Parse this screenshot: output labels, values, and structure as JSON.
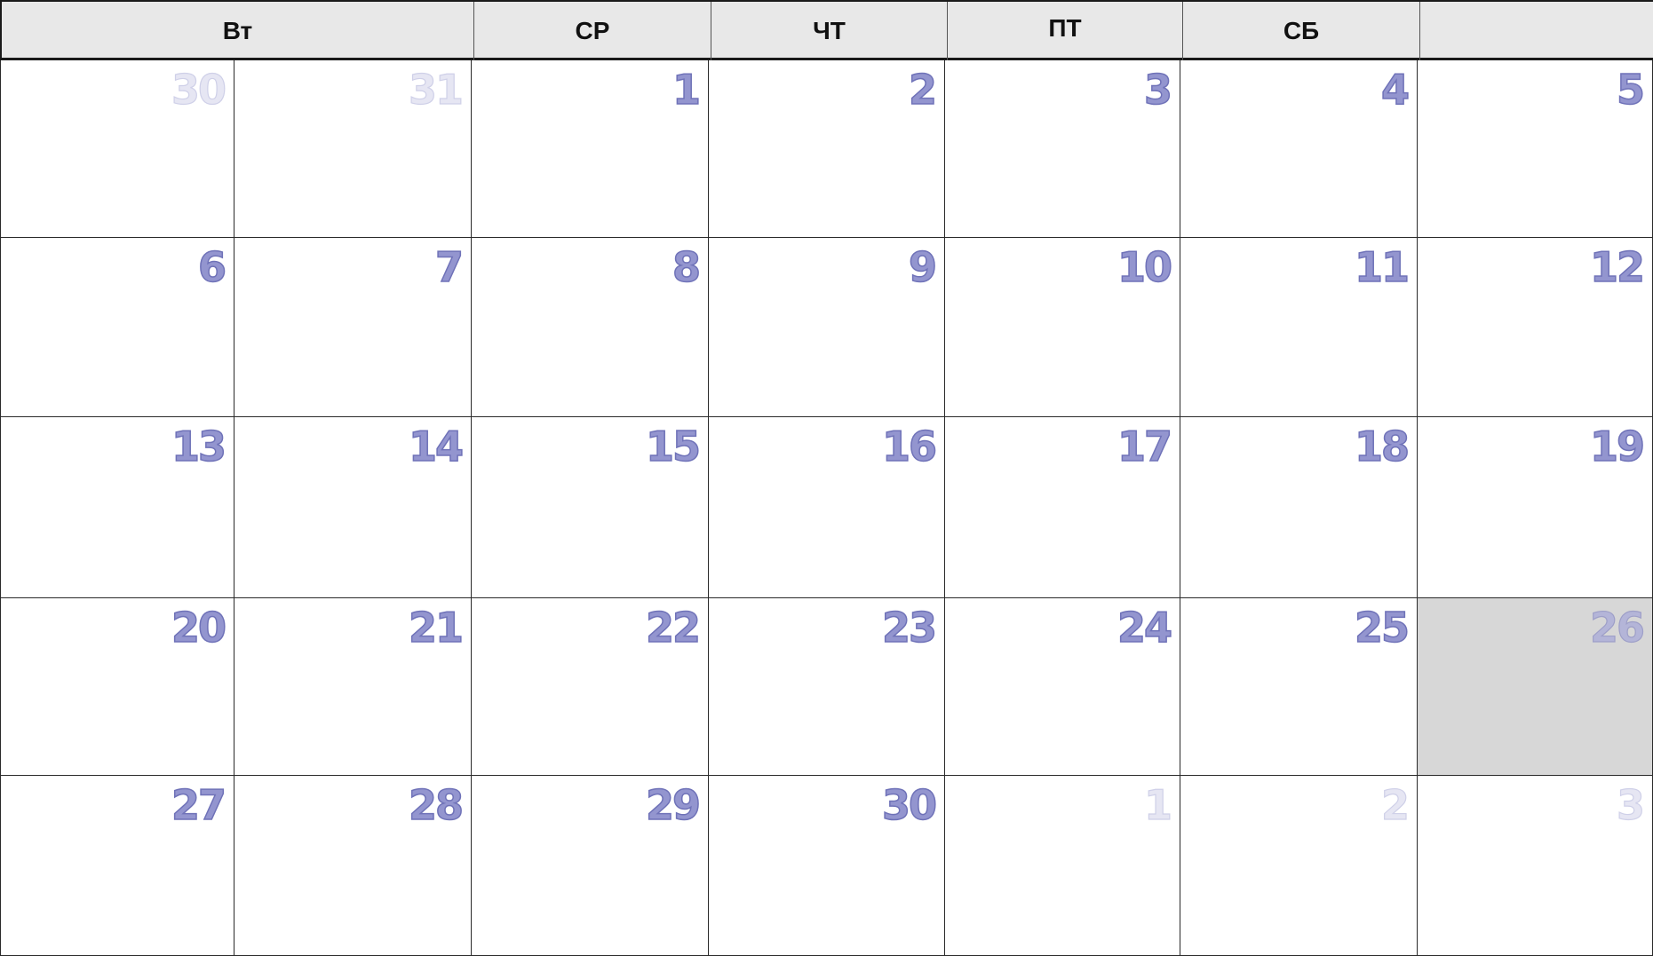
{
  "weekday_headers": [
    "",
    "Вт",
    "СР",
    "ЧТ",
    "ПТ",
    "СБ",
    ""
  ],
  "weeks": [
    [
      {
        "day": "30",
        "in_month": false
      },
      {
        "day": "31",
        "in_month": false
      },
      {
        "day": "1",
        "in_month": true
      },
      {
        "day": "2",
        "in_month": true
      },
      {
        "day": "3",
        "in_month": true
      },
      {
        "day": "4",
        "in_month": true
      },
      {
        "day": "5",
        "in_month": true
      }
    ],
    [
      {
        "day": "6",
        "in_month": true
      },
      {
        "day": "7",
        "in_month": true
      },
      {
        "day": "8",
        "in_month": true
      },
      {
        "day": "9",
        "in_month": true
      },
      {
        "day": "10",
        "in_month": true
      },
      {
        "day": "11",
        "in_month": true
      },
      {
        "day": "12",
        "in_month": true
      }
    ],
    [
      {
        "day": "13",
        "in_month": true
      },
      {
        "day": "14",
        "in_month": true
      },
      {
        "day": "15",
        "in_month": true
      },
      {
        "day": "16",
        "in_month": true
      },
      {
        "day": "17",
        "in_month": true
      },
      {
        "day": "18",
        "in_month": true
      },
      {
        "day": "19",
        "in_month": true
      }
    ],
    [
      {
        "day": "20",
        "in_month": true
      },
      {
        "day": "21",
        "in_month": true
      },
      {
        "day": "22",
        "in_month": true
      },
      {
        "day": "23",
        "in_month": true
      },
      {
        "day": "24",
        "in_month": true
      },
      {
        "day": "25",
        "in_month": true
      },
      {
        "day": "26",
        "in_month": true,
        "today": true
      }
    ],
    [
      {
        "day": "27",
        "in_month": true
      },
      {
        "day": "28",
        "in_month": true
      },
      {
        "day": "29",
        "in_month": true
      },
      {
        "day": "30",
        "in_month": true
      },
      {
        "day": "1",
        "in_month": false
      },
      {
        "day": "2",
        "in_month": false
      },
      {
        "day": "3",
        "in_month": false
      }
    ]
  ],
  "colors": {
    "header_bg": "#e8e8e8",
    "day_number": "#9395cf",
    "day_number_outline": "#6f72b8",
    "other_month_day": "#e6e6f3",
    "today_bg": "#d7d7d7"
  }
}
